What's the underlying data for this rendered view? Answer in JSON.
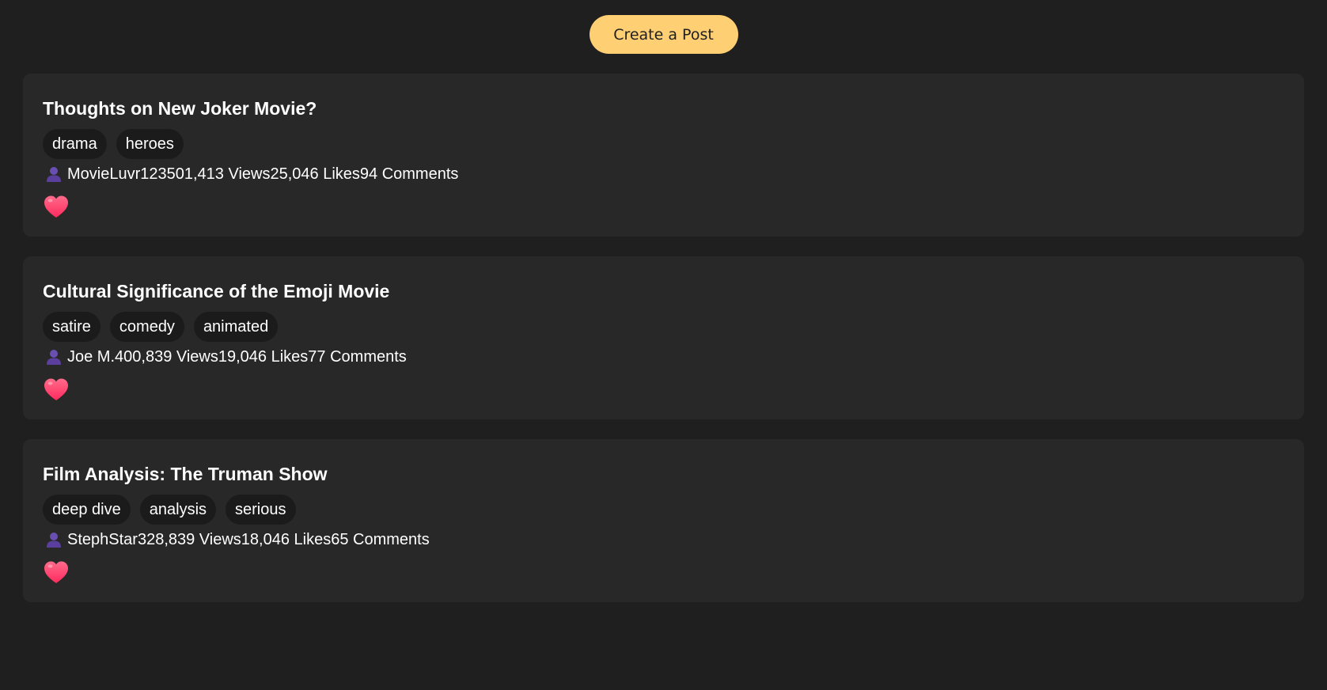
{
  "header": {
    "create_post_label": "Create a Post"
  },
  "colors": {
    "background": "#1f1f1f",
    "card": "#282828",
    "tag": "#1b1b1b",
    "accent": "#ffcf74",
    "heart": "#ff3d6e",
    "user_icon": "#6a4fb3"
  },
  "posts": [
    {
      "title": "Thoughts on New Joker Movie?",
      "tags": [
        "drama",
        "heroes"
      ],
      "author": "MovieLuvr123",
      "views": "501,413 Views",
      "likes": "25,046 Likes",
      "comments": "94 Comments",
      "icons": {
        "author": "user-icon",
        "like": "heart-icon"
      }
    },
    {
      "title": "Cultural Significance of the Emoji Movie",
      "tags": [
        "satire",
        "comedy",
        "animated"
      ],
      "author": "Joe M.",
      "views": "400,839 Views",
      "likes": "19,046 Likes",
      "comments": "77 Comments",
      "icons": {
        "author": "user-icon",
        "like": "heart-icon"
      }
    },
    {
      "title": "Film Analysis: The Truman Show",
      "tags": [
        "deep dive",
        "analysis",
        "serious"
      ],
      "author": "StephStar",
      "views": "328,839 Views",
      "likes": "18,046 Likes",
      "comments": "65 Comments",
      "icons": {
        "author": "user-icon",
        "like": "heart-icon"
      }
    }
  ]
}
